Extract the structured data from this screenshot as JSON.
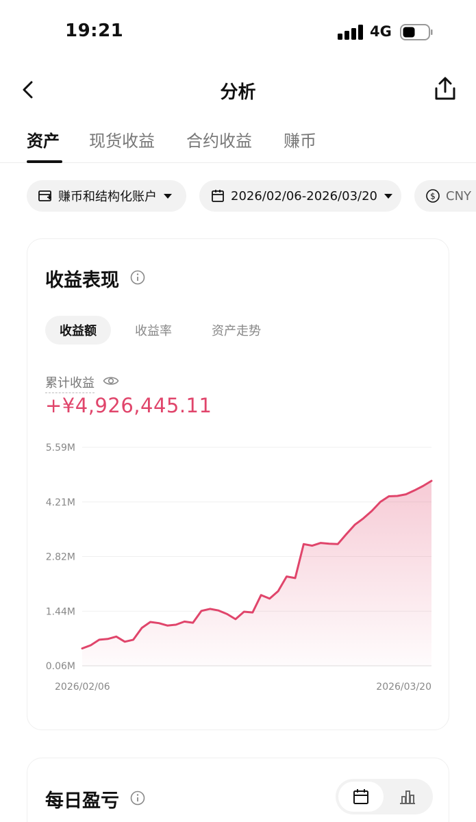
{
  "status": {
    "time": "19:21",
    "network": "4G"
  },
  "nav": {
    "title": "分析"
  },
  "tabs": [
    {
      "label": "资产",
      "active": true
    },
    {
      "label": "现货收益",
      "active": false
    },
    {
      "label": "合约收益",
      "active": false
    },
    {
      "label": "赚币",
      "active": false
    }
  ],
  "filters": {
    "account": "赚币和结构化账户",
    "date_range": "2026/02/06-2026/03/20",
    "currency": "CNY"
  },
  "performance": {
    "title": "收益表现",
    "segments": [
      {
        "label": "收益额",
        "active": true
      },
      {
        "label": "收益率",
        "active": false
      },
      {
        "label": "资产走势",
        "active": false
      }
    ],
    "cumulative_label": "累计收益",
    "cumulative_value": "+¥4,926,445.11"
  },
  "chart_data": {
    "type": "area",
    "y_ticks": [
      "5.59M",
      "4.21M",
      "2.82M",
      "1.44M",
      "0.06M"
    ],
    "ylim": [
      0.06,
      5.59
    ],
    "x_start_label": "2026/02/06",
    "x_end_label": "2026/03/20",
    "x_range": [
      "2026/02/06",
      "2026/03/20"
    ],
    "line_color": "#e0456b",
    "grid": true,
    "values": [
      0.5,
      0.58,
      0.72,
      0.74,
      0.8,
      0.67,
      0.72,
      1.02,
      1.17,
      1.14,
      1.08,
      1.1,
      1.18,
      1.15,
      1.45,
      1.5,
      1.46,
      1.37,
      1.24,
      1.43,
      1.41,
      1.85,
      1.76,
      1.95,
      2.32,
      2.28,
      3.14,
      3.1,
      3.17,
      3.15,
      3.14,
      3.39,
      3.63,
      3.79,
      3.98,
      4.21,
      4.35,
      4.36,
      4.4,
      4.5,
      4.61,
      4.74
    ]
  },
  "daily_pnl": {
    "title": "每日盈亏"
  }
}
